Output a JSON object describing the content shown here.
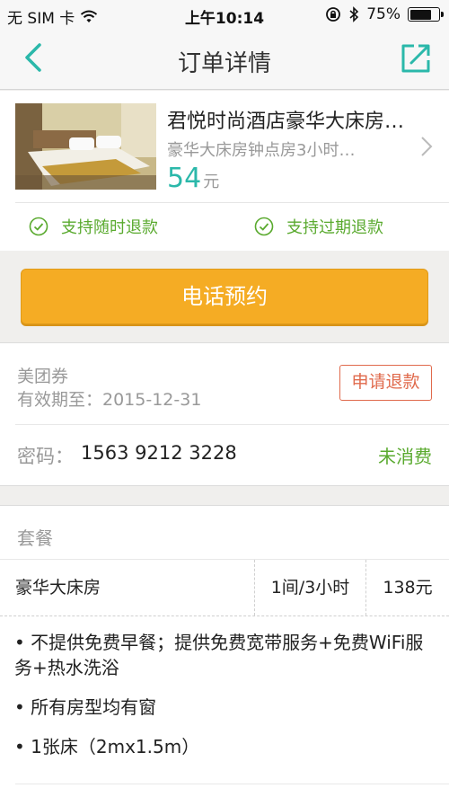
{
  "status_bar": {
    "carrier": "无 SIM 卡",
    "time": "上午10:14",
    "battery_percent": "75%",
    "battery_level": 0.75
  },
  "nav": {
    "title": "订单详情",
    "back_icon": "chevron-left-icon",
    "share_icon": "share-icon"
  },
  "product": {
    "title": "君悦时尚酒店豪华大床房…",
    "subtitle": "豪华大床房钟点房3小时…",
    "price": "54",
    "price_unit": "元",
    "refund_policies": [
      "支持随时退款",
      "支持过期退款"
    ]
  },
  "actions": {
    "call_button": "电话预约"
  },
  "voucher": {
    "label": "美团券",
    "expiry": "有效期至：2015-12-31",
    "refund_button": "申请退款",
    "code_label": "密码：",
    "code": "1563 9212 3228",
    "code_status": "未消费"
  },
  "package": {
    "title": "套餐",
    "item": {
      "name": "豪华大床房",
      "duration": "1间/3小时",
      "price": "138元"
    },
    "notes": [
      "• 不提供免费早餐；提供免费宽带服务+免费WiFi服务+热水洗浴",
      "• 所有房型均有窗",
      "• 1张床（2mx1.5m）"
    ]
  },
  "colors": {
    "accent_teal": "#2bb8aa",
    "green": "#5aaa2f",
    "orange_button": "#f5ac24",
    "refund_red": "#e06a4c"
  }
}
